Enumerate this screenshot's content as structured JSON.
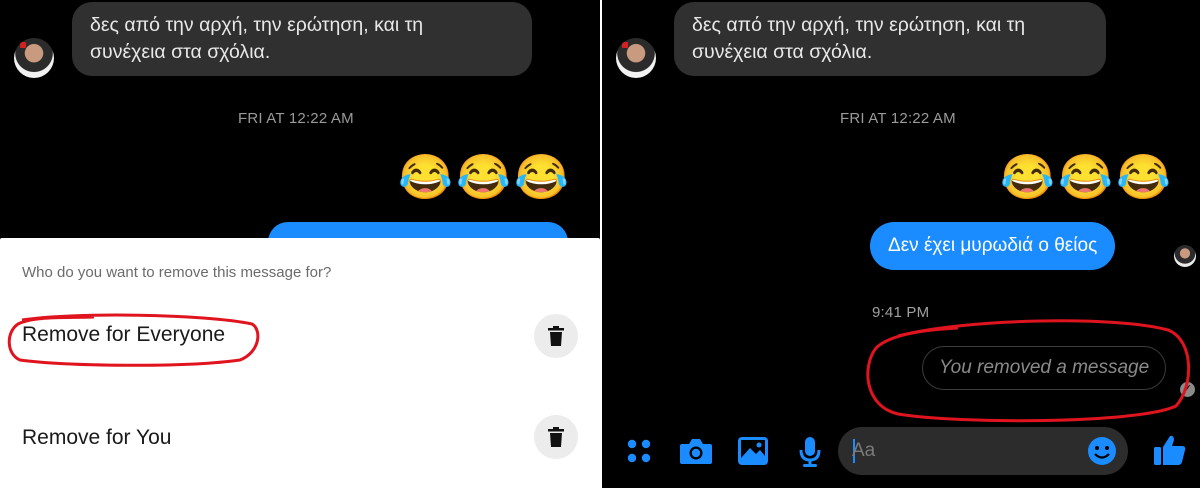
{
  "left": {
    "incoming_message": {
      "line1": "δες από την αρχή, την ερώτηση, και τη",
      "line2": "συνέχεια στα σχόλια."
    },
    "timestamp": "FRI AT 12:22 AM",
    "emojis": [
      "😂",
      "😂",
      "😂"
    ],
    "sheet": {
      "prompt": "Who do you want to remove this message for?",
      "option_everyone": "Remove for Everyone",
      "option_you": "Remove for You",
      "trash_icon": "trash-icon"
    }
  },
  "right": {
    "incoming_message": {
      "line1": "δες από την αρχή, την ερώτηση, και τη",
      "line2": "συνέχεια στα σχόλια."
    },
    "timestamp": "FRI AT 12:22 AM",
    "emojis": [
      "😂",
      "😂",
      "😂"
    ],
    "outgoing_message": "Δεν έχει μυρωδιά ο θείος",
    "sent_time": "9:41 PM",
    "removed_notice": "You removed a message",
    "composer": {
      "placeholder": "Aa",
      "icons": [
        "apps-icon",
        "camera-icon",
        "image-icon",
        "microphone-icon",
        "emoji-icon",
        "thumbs-up-icon"
      ]
    }
  },
  "colors": {
    "messenger_blue": "#1a8cff",
    "annotation_red": "#e0141e",
    "incoming_bubble": "#303030",
    "sheet_background": "#ffffff"
  }
}
